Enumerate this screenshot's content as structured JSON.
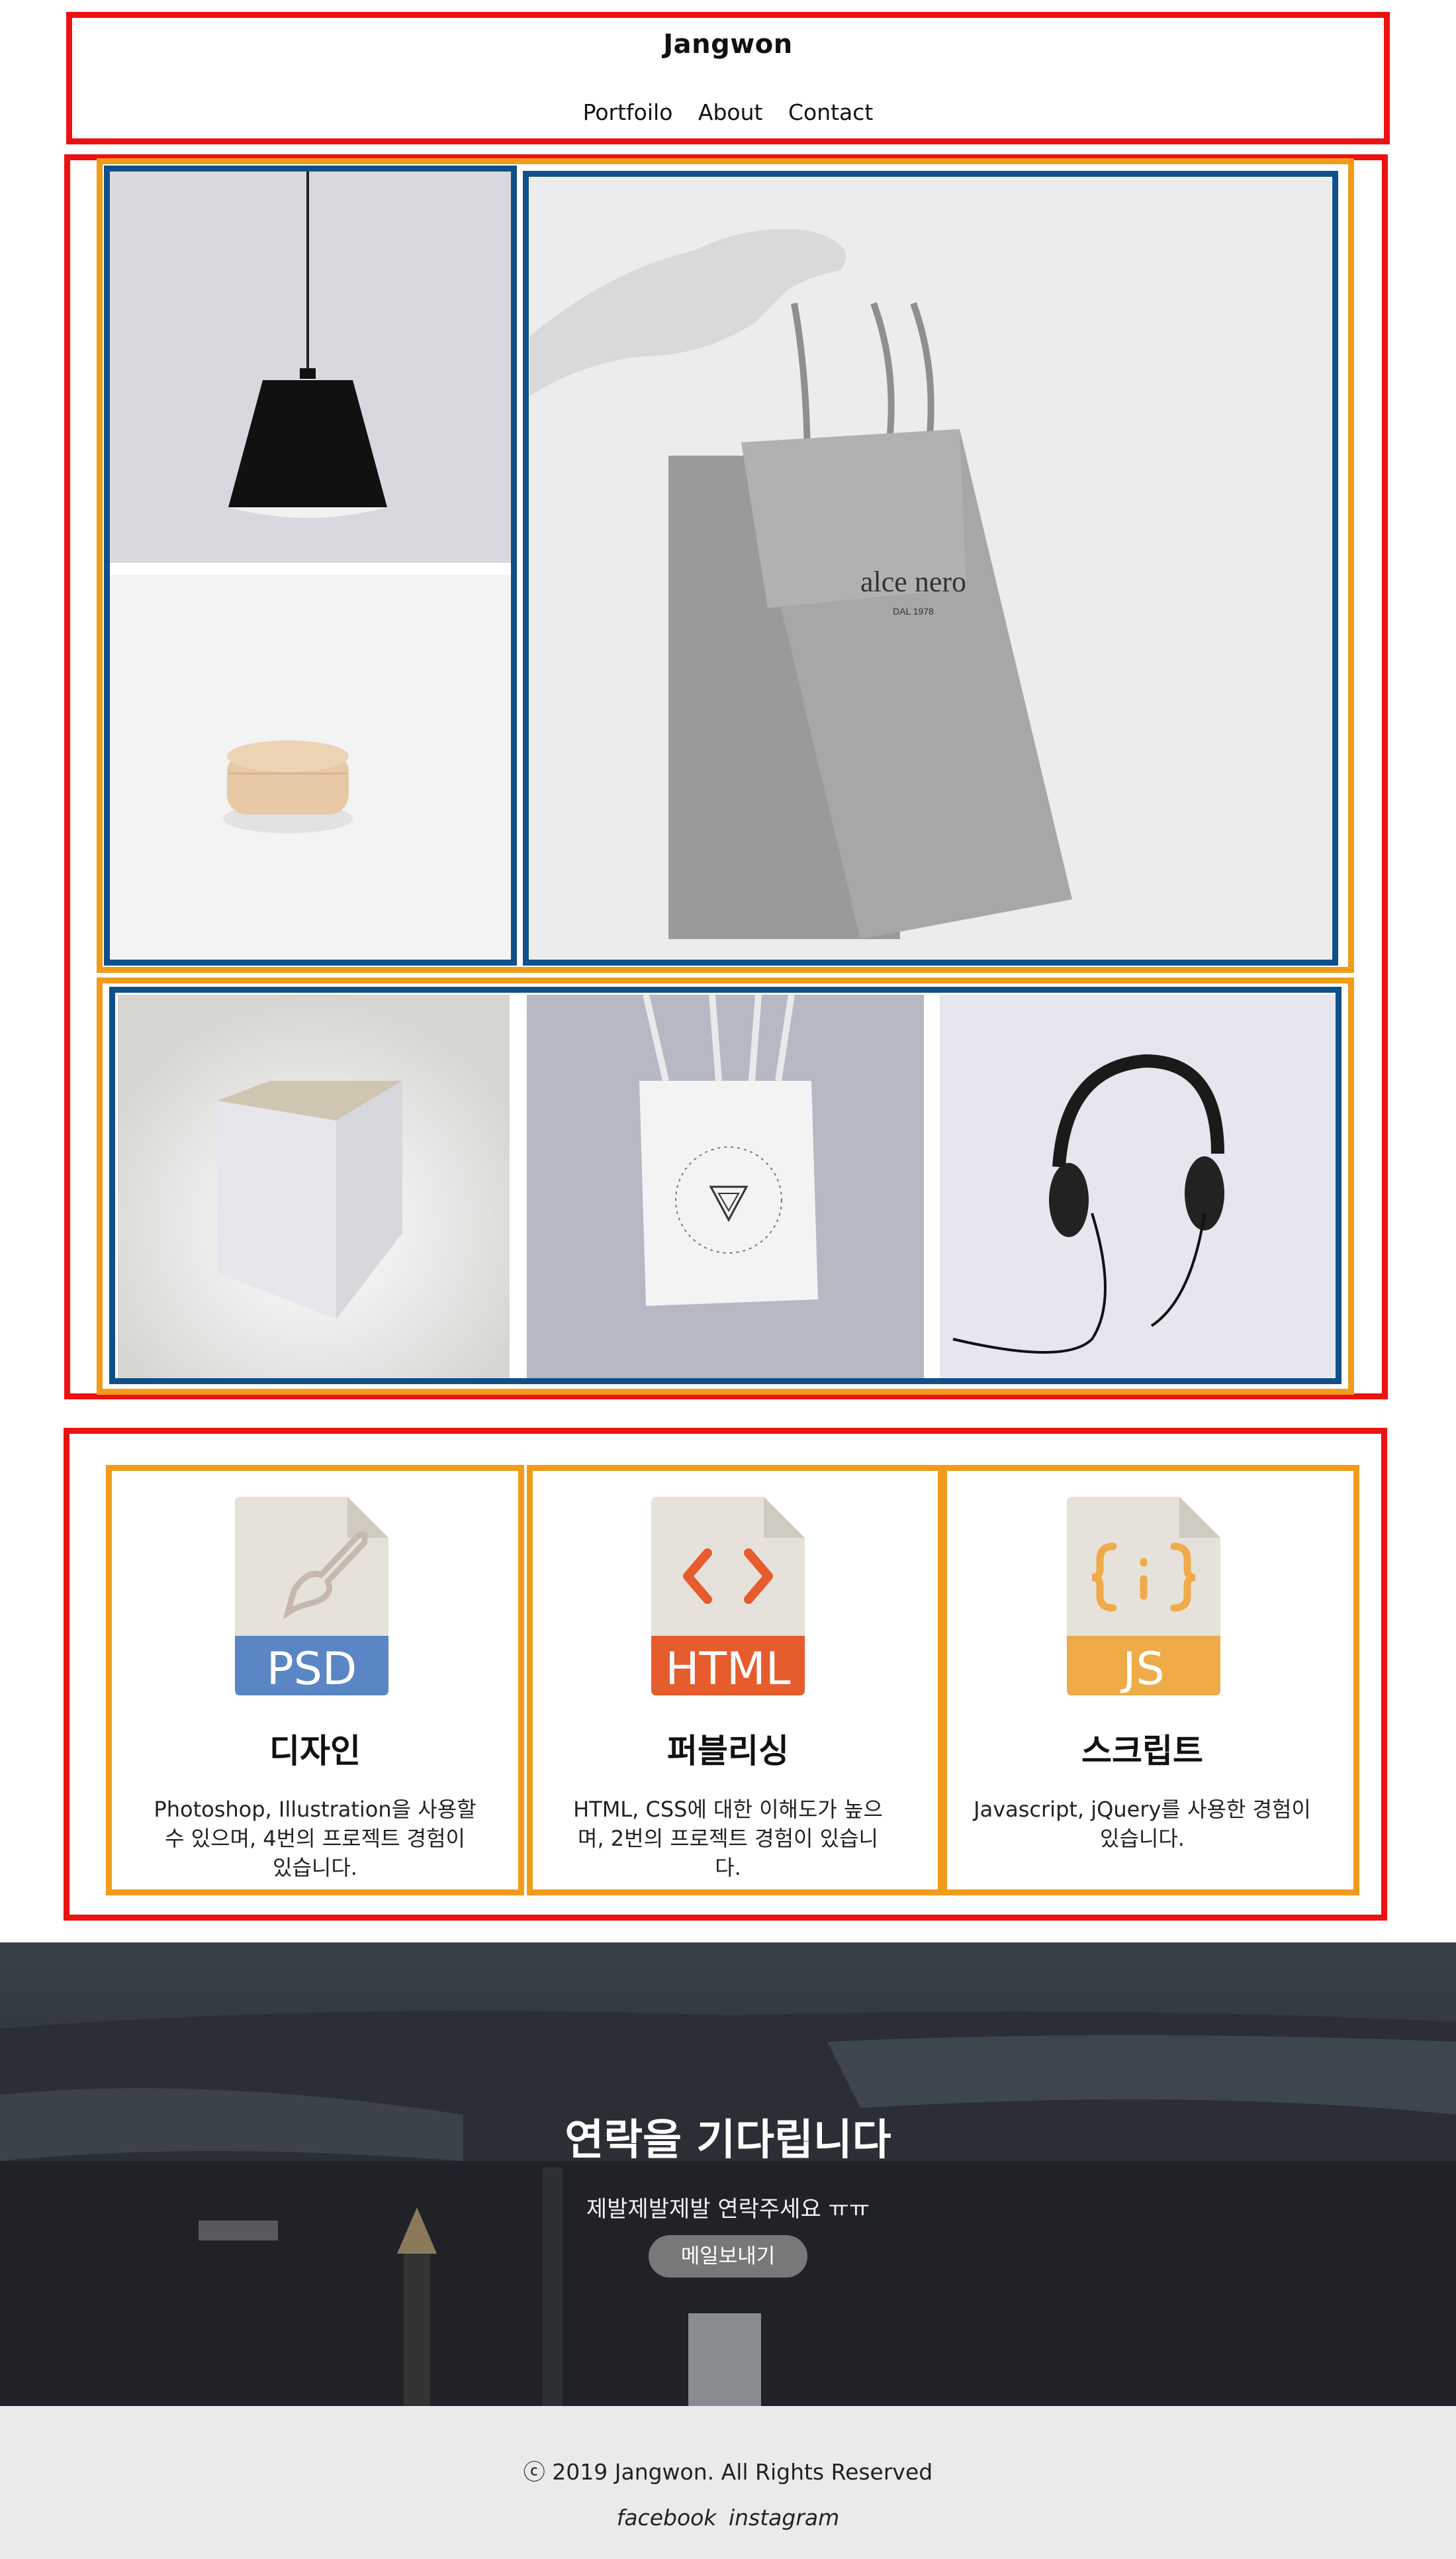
{
  "header": {
    "title": "Jangwon",
    "nav": [
      "Portfoilo",
      "About",
      "Contact"
    ]
  },
  "portfolio": {
    "items": [
      {
        "name": "pendant-lamp",
        "colors": {
          "bg": "#d9d8de"
        }
      },
      {
        "name": "wooden-box",
        "colors": {
          "bg": "#f3f3f4"
        }
      },
      {
        "name": "shopping-bag",
        "text": "alce nero",
        "subtext": "DAL 1978",
        "colors": {
          "bg": "#ececee"
        }
      },
      {
        "name": "cube-lamp",
        "colors": {
          "bg": "#d6d5d2"
        }
      },
      {
        "name": "tote-bag",
        "colors": {
          "bg": "#b6b8c3"
        }
      },
      {
        "name": "headphones",
        "colors": {
          "bg": "#e6e6ee"
        }
      }
    ]
  },
  "services": [
    {
      "icon_label": "PSD",
      "icon": "brush-icon",
      "title": "디자인",
      "desc_lines": [
        "Photoshop, Illustration을 사용할",
        "수 있으며, 4번의 프로젝트 경험이",
        "있습니다."
      ],
      "color": "#5b86c5"
    },
    {
      "icon_label": "HTML",
      "icon": "code-brackets-icon",
      "title": "퍼블리싱",
      "desc_lines": [
        "HTML, CSS에 대한 이해도가 높으",
        "며, 2번의 프로젝트 경험이 있습니",
        "다."
      ],
      "color": "#e65c2c"
    },
    {
      "icon_label": "JS",
      "icon": "curly-braces-icon",
      "title": "스크립트",
      "desc_lines": [
        "Javascript, jQuery를 사용한 경험이",
        "있습니다."
      ],
      "color": "#eeab47"
    }
  ],
  "contact": {
    "title": "연락을 기다립니다",
    "subtitle": "제발제발제발 연락주세요 ㅠㅠ",
    "button": "메일보내기"
  },
  "footer": {
    "copyright": "ⓒ 2019 Jangwon. All Rights Reserved",
    "links": [
      "facebook",
      "instagram"
    ]
  },
  "colors": {
    "outline_red": "#ee1111",
    "outline_orange": "#f09c1a",
    "outline_blue": "#114f8a",
    "footer_bg": "#eaeaea"
  }
}
